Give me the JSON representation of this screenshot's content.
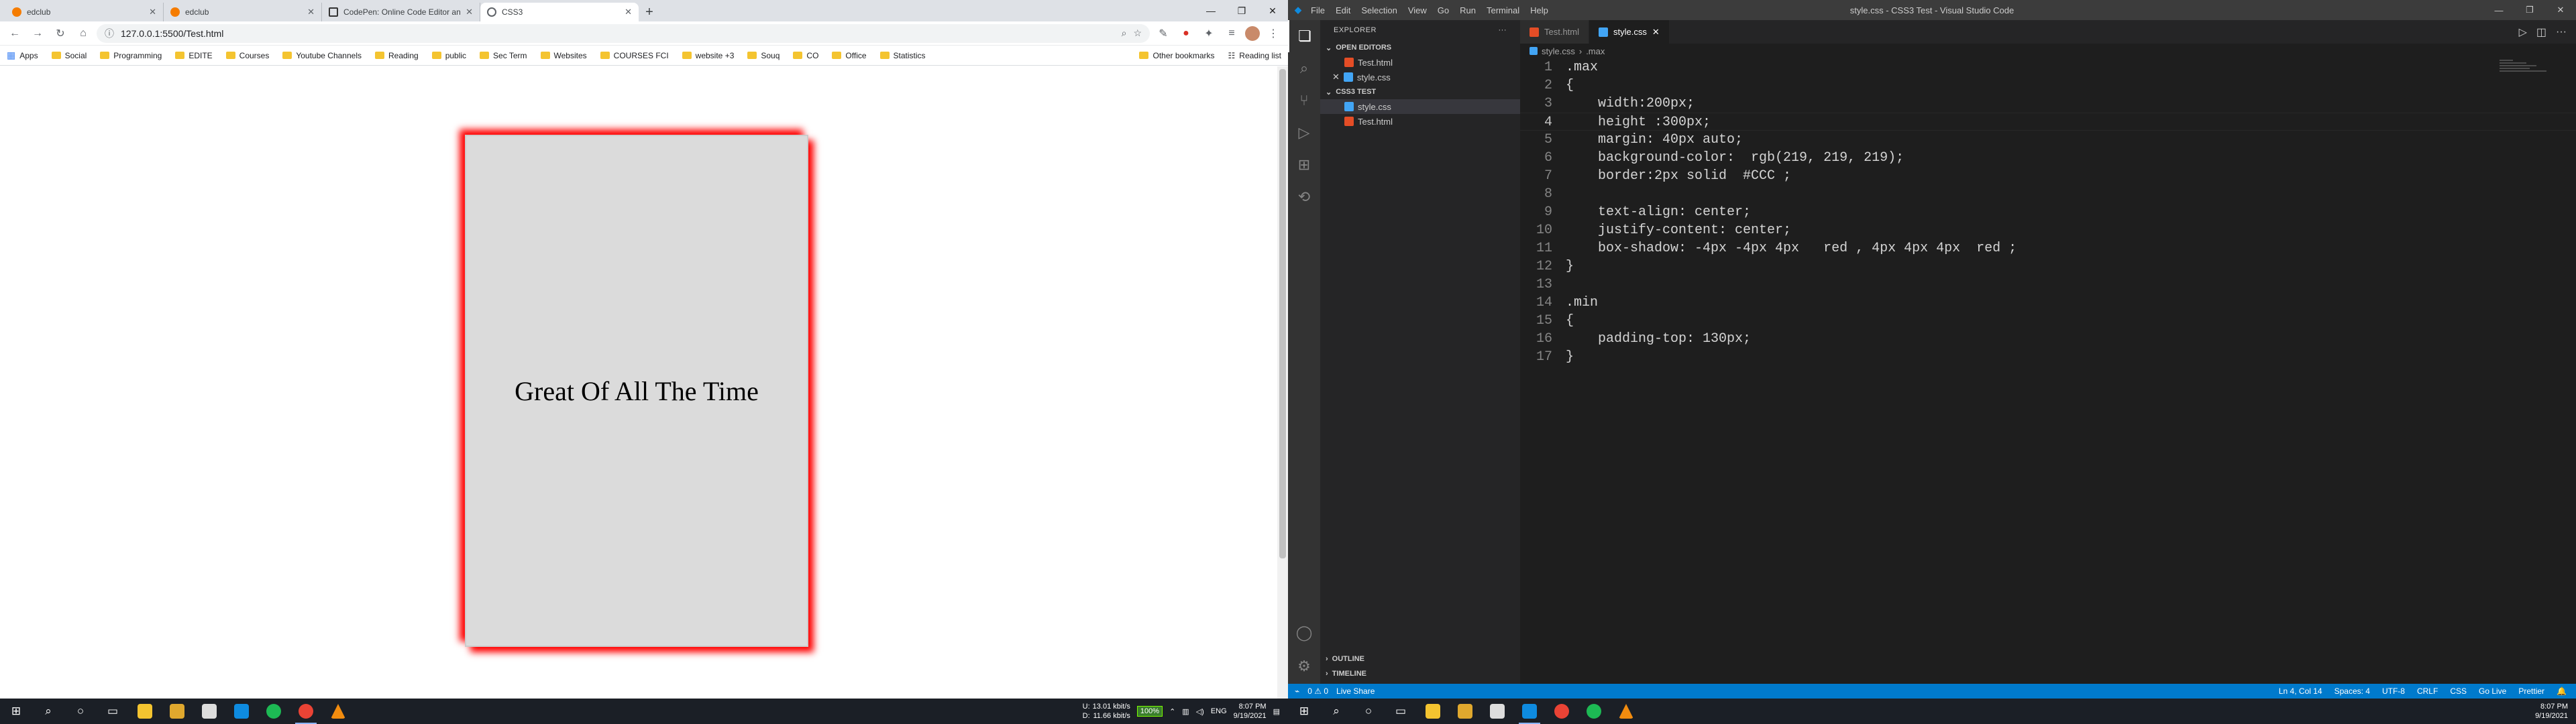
{
  "chrome": {
    "tabs": [
      {
        "title": "edclub",
        "active": false
      },
      {
        "title": "edclub",
        "active": false
      },
      {
        "title": "CodePen: Online Code Editor and",
        "active": false
      },
      {
        "title": "CSS3",
        "active": true
      }
    ],
    "address": "127.0.0.1:5500/Test.html",
    "bookmarks": [
      "Apps",
      "Social",
      "Programming",
      "EDITE",
      "Courses",
      "Youtube Channels",
      "Reading",
      "public",
      "Sec Term",
      "Websites",
      "COURSES FCI",
      "website +3",
      "Souq",
      "CO",
      "Office",
      "Statistics"
    ],
    "bookmarks_right": [
      "Other bookmarks",
      "Reading list"
    ]
  },
  "page": {
    "box_text": "Great Of All The Time"
  },
  "vscode": {
    "menu": [
      "File",
      "Edit",
      "Selection",
      "View",
      "Go",
      "Run",
      "Terminal",
      "Help"
    ],
    "window_title": "style.css - CSS3 Test - Visual Studio Code",
    "explorer_title": "EXPLORER",
    "open_editors_label": "OPEN EDITORS",
    "open_editors": [
      "Test.html",
      "style.css"
    ],
    "workspace_label": "CSS3 TEST",
    "files": [
      "style.css",
      "Test.html"
    ],
    "outline_label": "OUTLINE",
    "timeline_label": "TIMELINE",
    "editor_tabs": [
      "Test.html",
      "style.css"
    ],
    "breadcrumb": [
      "style.css",
      ".max"
    ],
    "code_lines": [
      ".max",
      "{",
      "    width:200px;",
      "    height :300px;",
      "    margin: 40px auto;",
      "    background-color:  rgb(219, 219, 219);",
      "    border:2px solid  #CCC ;",
      "",
      "    text-align: center;",
      "    justify-content: center;",
      "    box-shadow: -4px -4px 4px   red , 4px 4px 4px  red ;",
      "}",
      "",
      ".min",
      "{",
      "    padding-top: 130px;",
      "}"
    ],
    "status_left": [
      "0 ⚠ 0",
      "Live Share"
    ],
    "status_right": [
      "Ln 4, Col 14",
      "Spaces: 4",
      "UTF-8",
      "CRLF",
      "CSS",
      "Go Live",
      "Prettier"
    ]
  },
  "taskbar_left": {
    "net_up": "13.01 kbit/s",
    "net_down": "11.66 kbit/s",
    "net_up_label": "U:",
    "net_down_label": "D:",
    "battery": "100%",
    "lang": "ENG",
    "time": "8:07 PM",
    "date": "9/19/2021"
  },
  "taskbar_right": {
    "time": "8:07 PM",
    "date": "9/19/2021"
  },
  "colors": {
    "vscode_blue": "#007acc",
    "shadow_red": "#ff0000",
    "box_gray": "#dbdbdb"
  }
}
